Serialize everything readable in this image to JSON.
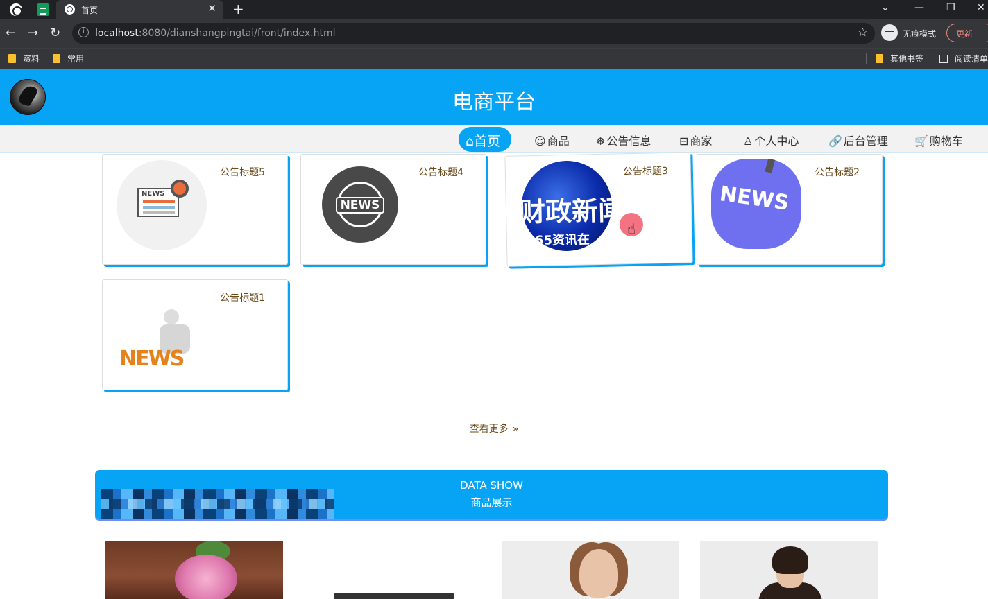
{
  "browser": {
    "tab_title": "首页",
    "tab_close": "✕",
    "new_tab": "+",
    "url_host": "localhost",
    "url_rest": ":8080/dianshangpingtai/front/index.html",
    "incognito_label": "无痕模式",
    "update_label": "更新",
    "bookmarks": [
      "资料",
      "常用"
    ],
    "bookmarks_right": [
      "其他书签",
      "阅读清单"
    ]
  },
  "site": {
    "title": "电商平台"
  },
  "nav": {
    "items": [
      {
        "icon": "⌂",
        "label": "首页"
      },
      {
        "icon": "☺",
        "label": "商品"
      },
      {
        "icon": "❄",
        "label": "公告信息"
      },
      {
        "icon": "⊟",
        "label": "商家"
      },
      {
        "icon": "♙",
        "label": "个人中心"
      },
      {
        "icon": "🔗",
        "label": "后台管理"
      },
      {
        "icon": "🛒",
        "label": "购物车"
      }
    ]
  },
  "notices": [
    {
      "title": "公告标题5",
      "image_text": "NEWS"
    },
    {
      "title": "公告标题4",
      "image_text": "NEWS"
    },
    {
      "title": "公告标题3",
      "image_text": "财政新闻",
      "image_subtext": "65资讯在"
    },
    {
      "title": "公告标题2",
      "image_text": "NEWS"
    },
    {
      "title": "公告标题1",
      "image_text": "NEWS"
    }
  ],
  "more": {
    "label": "查看更多",
    "icon": "»"
  },
  "data_show": {
    "en": "DATA SHOW",
    "cn": "商品展示"
  },
  "colors": {
    "primary": "#07a4f5",
    "card_text": "#6a4a1a",
    "chrome_dark": "#202124",
    "chrome_mid": "#35363a"
  }
}
